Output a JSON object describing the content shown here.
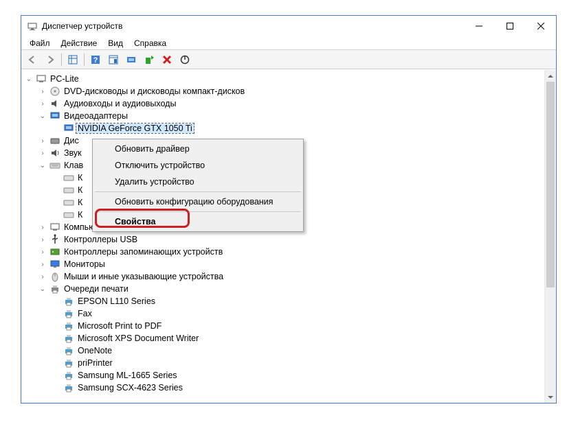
{
  "window": {
    "title": "Диспетчер устройств"
  },
  "menu": {
    "file": "Файл",
    "action": "Действие",
    "view": "Вид",
    "help": "Справка"
  },
  "tree": {
    "root": "PC-Lite",
    "items": [
      {
        "label": "DVD-дисководы и дисководы компакт-дисков"
      },
      {
        "label": "Аудиовходы и аудиовыходы"
      },
      {
        "label": "Видеоадаптеры",
        "expanded": true,
        "children": [
          {
            "label": "NVIDIA GeForce GTX 1050 Ti",
            "selected": true
          }
        ]
      },
      {
        "label": "Дис"
      },
      {
        "label": "Звук"
      },
      {
        "label": "Клав",
        "expanded": true,
        "children": [
          {
            "label": "К"
          },
          {
            "label": "К"
          },
          {
            "label": "К"
          },
          {
            "label": "К"
          }
        ]
      },
      {
        "label": "Компьютер"
      },
      {
        "label": "Контроллеры USB"
      },
      {
        "label": "Контроллеры запоминающих устройств"
      },
      {
        "label": "Мониторы"
      },
      {
        "label": "Мыши и иные указывающие устройства"
      },
      {
        "label": "Очереди печати",
        "expanded": true,
        "children": [
          {
            "label": "EPSON L110 Series"
          },
          {
            "label": "Fax"
          },
          {
            "label": "Microsoft Print to PDF"
          },
          {
            "label": "Microsoft XPS Document Writer"
          },
          {
            "label": "OneNote"
          },
          {
            "label": "priPrinter"
          },
          {
            "label": "Samsung ML-1665 Series"
          },
          {
            "label": "Samsung SCX-4623 Series"
          }
        ]
      }
    ]
  },
  "context_menu": {
    "update_driver": "Обновить драйвер",
    "disable_device": "Отключить устройство",
    "delete_device": "Удалить устройство",
    "refresh_config": "Обновить конфигурацию оборудования",
    "properties": "Свойства"
  }
}
